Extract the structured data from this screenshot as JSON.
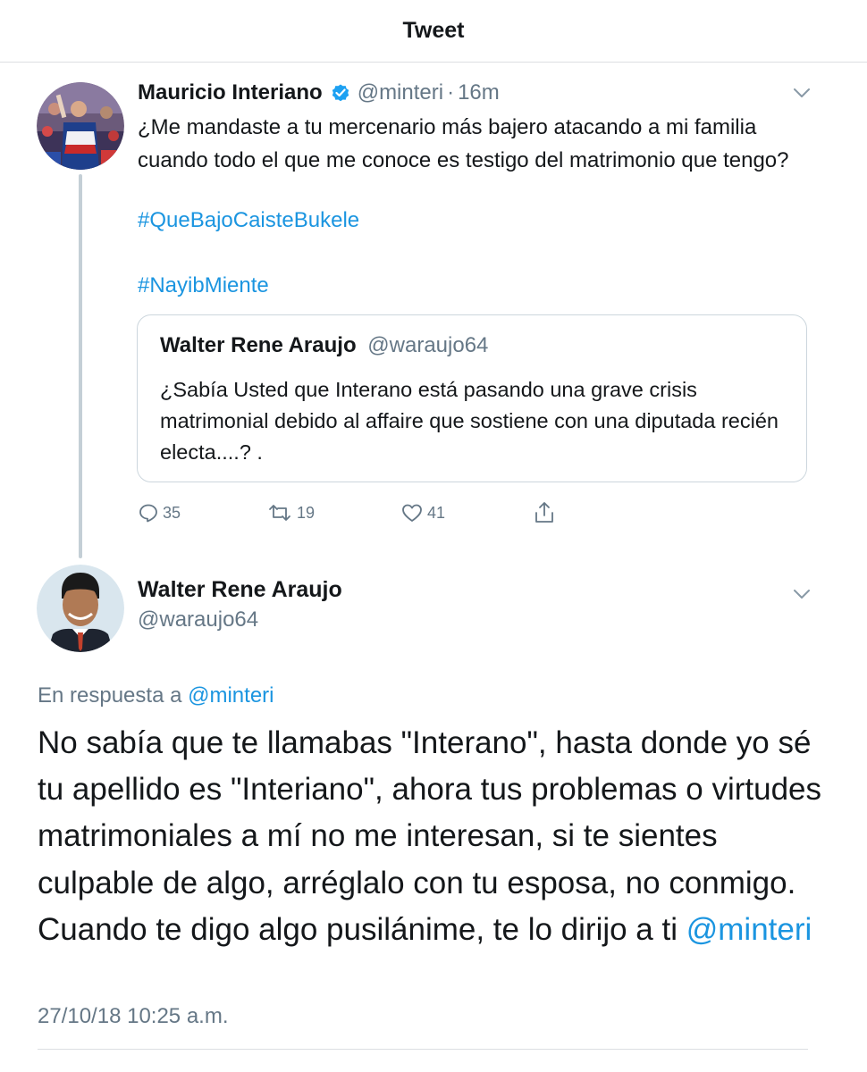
{
  "header": {
    "title": "Tweet"
  },
  "tweet1": {
    "author_name": "Mauricio Interiano",
    "handle": "@minteri",
    "separator": "·",
    "time": "16m",
    "body": "¿Me mandaste a tu mercenario más bajero atacando a mi familia cuando todo el que me conoce es testigo del matrimonio que tengo?",
    "hashtags": [
      "#QueBajoCaisteBukele",
      "#NayibMiente"
    ],
    "quote": {
      "author_name": "Walter Rene Araujo",
      "handle": "@waraujo64",
      "body": "¿Sabía Usted que Interano está pasando una grave crisis matrimonial debido al affaire que sostiene con una diputada recién electa....? ."
    },
    "actions": {
      "replies": "35",
      "retweets": "19",
      "likes": "41"
    }
  },
  "tweet2": {
    "author_name": "Walter Rene Araujo",
    "handle": "@waraujo64",
    "reply_prefix": "En respuesta a",
    "reply_mention": "@minteri",
    "body": "No sabía que te llamabas \"Interano\", hasta donde yo sé tu apellido es \"Interiano\", ahora tus problemas o virtudes matrimoniales a mí no me interesan, si te sientes culpable de algo, arréglalo con tu esposa, no conmigo. Cuando te digo algo pusilánime, te lo dirijo a ti",
    "body_mention": "@minteri",
    "timestamp": "27/10/18 10:25 a.m."
  },
  "colors": {
    "link": "#1b95e0",
    "muted": "#657786",
    "text": "#14171a",
    "border": "#ccd6dd"
  },
  "icons": [
    "verified-badge-icon",
    "chevron-down-icon",
    "reply-icon",
    "retweet-icon",
    "like-icon",
    "share-icon"
  ]
}
